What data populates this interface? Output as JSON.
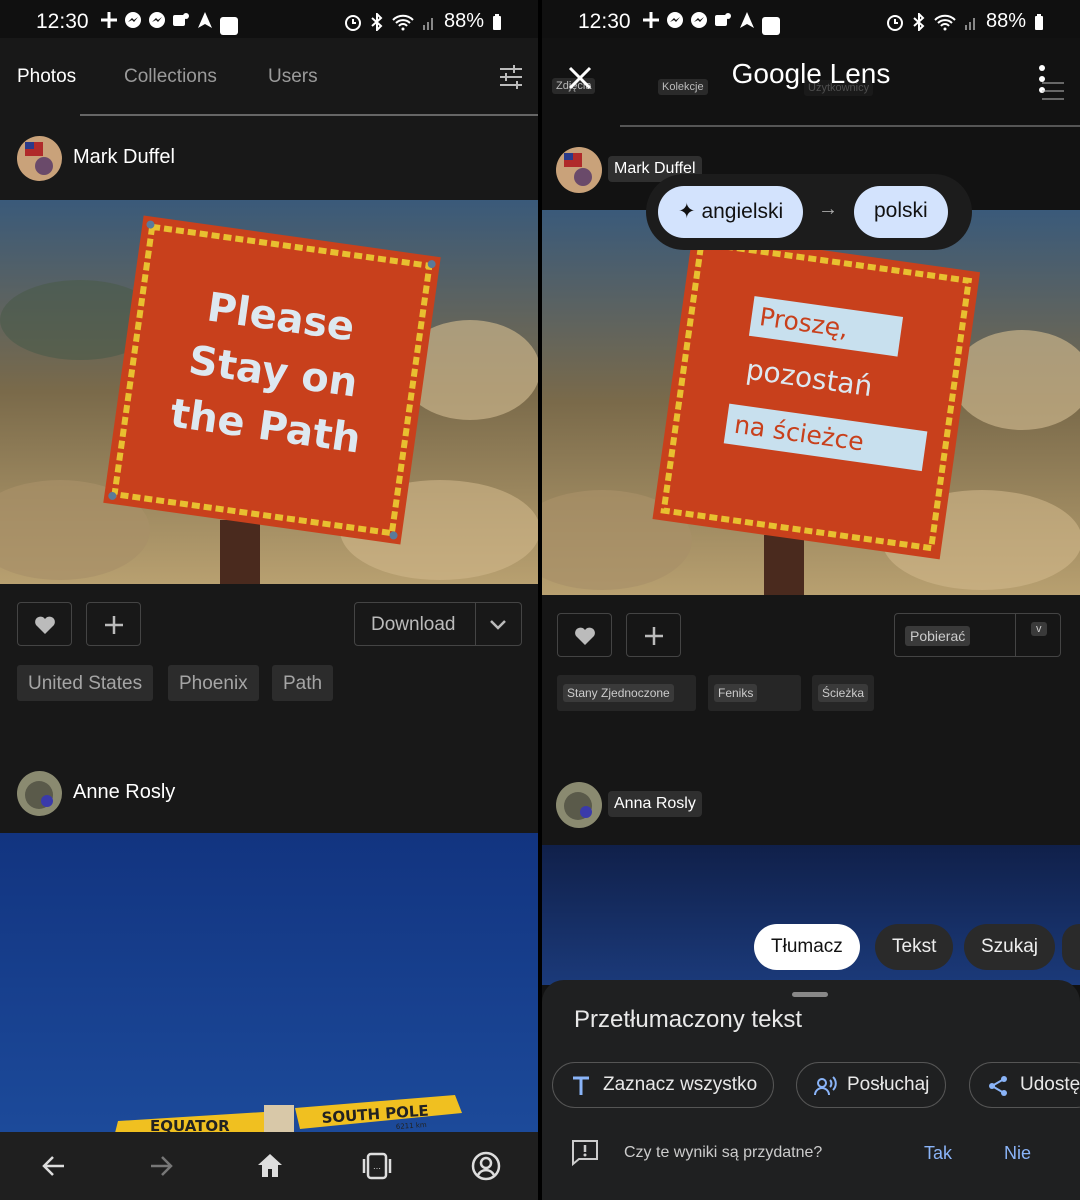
{
  "status": {
    "time": "12:30",
    "battery": "88%"
  },
  "left": {
    "tabs": [
      "Photos",
      "Collections",
      "Users"
    ],
    "user1": "Mark Duffel",
    "sign_lines": [
      "Please",
      "Stay on",
      "the Path"
    ],
    "download_label": "Download",
    "tags": [
      "United States",
      "Phoenix",
      "Path"
    ],
    "user2": "Anne Rosly",
    "signpost": {
      "left": "EQUATOR",
      "right": "SOUTH POLE",
      "dist": "6211 km"
    }
  },
  "right": {
    "app_title": "Google Lens",
    "faint_tabs": [
      "Zdjęcia",
      "Kolekcje",
      "Użytkownicy"
    ],
    "user1": "Mark Duffel",
    "lang_from": "angielski",
    "lang_to": "polski",
    "sign_lines": [
      "Proszę,",
      "pozostań",
      "na ścieżce"
    ],
    "download_label": "Pobierać",
    "download_chev": "v",
    "tags": [
      "Stany Zjednoczone",
      "Feniks",
      "Ścieżka"
    ],
    "user2": "Anna Rosly",
    "modes": [
      "Tłumacz",
      "Tekst",
      "Szukaj"
    ],
    "sheet_title": "Przetłumaczony tekst",
    "actions": [
      "Zaznacz wszystko",
      "Posłuchaj",
      "Udostę"
    ],
    "feedback_q": "Czy te wyniki są przydatne?",
    "yes": "Tak",
    "no": "Nie"
  }
}
